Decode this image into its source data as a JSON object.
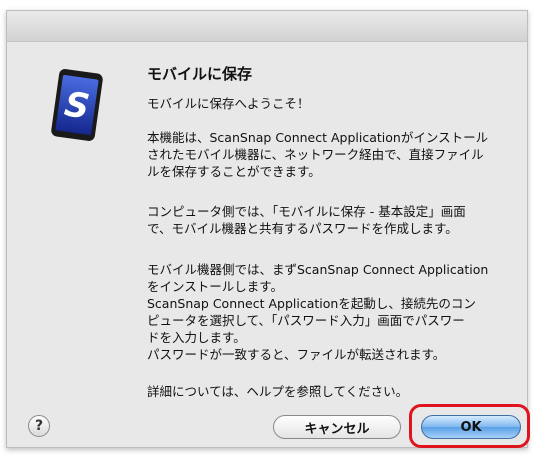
{
  "dialog": {
    "title": "モバイルに保存",
    "welcome": "モバイルに保存へようこそ！",
    "paragraph2_lines": [
      "本機能は、ScanSnap Connect Applicationがインストール",
      "されたモバイル機器に、ネットワーク経由で、直接ファイル",
      "ルを保存することができます。"
    ],
    "paragraph3_lines": [
      "コンピュータ側では、「モバイルに保存 - 基本設定」画面",
      "で、モバイル機器と共有するパスワードを作成します。"
    ],
    "paragraph4_lines": [
      "モバイル機器側では、まずScanSnap Connect Application",
      "をインストールします。",
      "ScanSnap Connect Applicationを起動し、接続先のコン",
      "ピュータを選択して、「パスワード入力」画面でパスワー",
      "ドを入力します。",
      "パスワードが一致すると、ファイルが転送されます。"
    ],
    "paragraph5": "詳細については、ヘルプを参照してください。"
  },
  "buttons": {
    "help_label": "?",
    "cancel_label": "キャンセル",
    "ok_label": "OK"
  },
  "colors": {
    "highlight": "#e0141e",
    "icon_blue": "#1f3fb5",
    "default_button": "#5aa0e6"
  },
  "icons": {
    "app": "scansnap-s-tablet-icon",
    "help": "question-icon"
  }
}
